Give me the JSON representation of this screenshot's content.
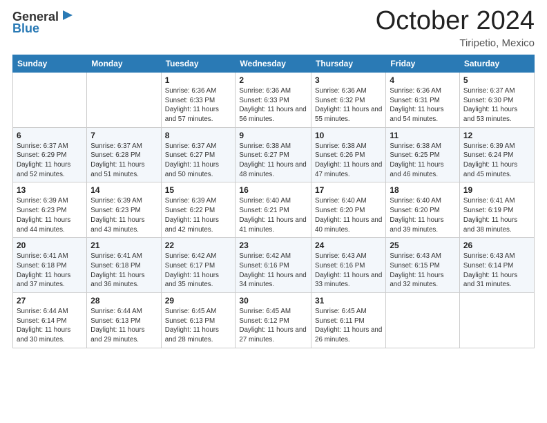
{
  "header": {
    "logo_general": "General",
    "logo_blue": "Blue",
    "month": "October 2024",
    "location": "Tiripetio, Mexico"
  },
  "weekdays": [
    "Sunday",
    "Monday",
    "Tuesday",
    "Wednesday",
    "Thursday",
    "Friday",
    "Saturday"
  ],
  "weeks": [
    [
      {
        "day": "",
        "info": ""
      },
      {
        "day": "",
        "info": ""
      },
      {
        "day": "1",
        "info": "Sunrise: 6:36 AM\nSunset: 6:33 PM\nDaylight: 11 hours and 57 minutes."
      },
      {
        "day": "2",
        "info": "Sunrise: 6:36 AM\nSunset: 6:33 PM\nDaylight: 11 hours and 56 minutes."
      },
      {
        "day": "3",
        "info": "Sunrise: 6:36 AM\nSunset: 6:32 PM\nDaylight: 11 hours and 55 minutes."
      },
      {
        "day": "4",
        "info": "Sunrise: 6:36 AM\nSunset: 6:31 PM\nDaylight: 11 hours and 54 minutes."
      },
      {
        "day": "5",
        "info": "Sunrise: 6:37 AM\nSunset: 6:30 PM\nDaylight: 11 hours and 53 minutes."
      }
    ],
    [
      {
        "day": "6",
        "info": "Sunrise: 6:37 AM\nSunset: 6:29 PM\nDaylight: 11 hours and 52 minutes."
      },
      {
        "day": "7",
        "info": "Sunrise: 6:37 AM\nSunset: 6:28 PM\nDaylight: 11 hours and 51 minutes."
      },
      {
        "day": "8",
        "info": "Sunrise: 6:37 AM\nSunset: 6:27 PM\nDaylight: 11 hours and 50 minutes."
      },
      {
        "day": "9",
        "info": "Sunrise: 6:38 AM\nSunset: 6:27 PM\nDaylight: 11 hours and 48 minutes."
      },
      {
        "day": "10",
        "info": "Sunrise: 6:38 AM\nSunset: 6:26 PM\nDaylight: 11 hours and 47 minutes."
      },
      {
        "day": "11",
        "info": "Sunrise: 6:38 AM\nSunset: 6:25 PM\nDaylight: 11 hours and 46 minutes."
      },
      {
        "day": "12",
        "info": "Sunrise: 6:39 AM\nSunset: 6:24 PM\nDaylight: 11 hours and 45 minutes."
      }
    ],
    [
      {
        "day": "13",
        "info": "Sunrise: 6:39 AM\nSunset: 6:23 PM\nDaylight: 11 hours and 44 minutes."
      },
      {
        "day": "14",
        "info": "Sunrise: 6:39 AM\nSunset: 6:23 PM\nDaylight: 11 hours and 43 minutes."
      },
      {
        "day": "15",
        "info": "Sunrise: 6:39 AM\nSunset: 6:22 PM\nDaylight: 11 hours and 42 minutes."
      },
      {
        "day": "16",
        "info": "Sunrise: 6:40 AM\nSunset: 6:21 PM\nDaylight: 11 hours and 41 minutes."
      },
      {
        "day": "17",
        "info": "Sunrise: 6:40 AM\nSunset: 6:20 PM\nDaylight: 11 hours and 40 minutes."
      },
      {
        "day": "18",
        "info": "Sunrise: 6:40 AM\nSunset: 6:20 PM\nDaylight: 11 hours and 39 minutes."
      },
      {
        "day": "19",
        "info": "Sunrise: 6:41 AM\nSunset: 6:19 PM\nDaylight: 11 hours and 38 minutes."
      }
    ],
    [
      {
        "day": "20",
        "info": "Sunrise: 6:41 AM\nSunset: 6:18 PM\nDaylight: 11 hours and 37 minutes."
      },
      {
        "day": "21",
        "info": "Sunrise: 6:41 AM\nSunset: 6:18 PM\nDaylight: 11 hours and 36 minutes."
      },
      {
        "day": "22",
        "info": "Sunrise: 6:42 AM\nSunset: 6:17 PM\nDaylight: 11 hours and 35 minutes."
      },
      {
        "day": "23",
        "info": "Sunrise: 6:42 AM\nSunset: 6:16 PM\nDaylight: 11 hours and 34 minutes."
      },
      {
        "day": "24",
        "info": "Sunrise: 6:43 AM\nSunset: 6:16 PM\nDaylight: 11 hours and 33 minutes."
      },
      {
        "day": "25",
        "info": "Sunrise: 6:43 AM\nSunset: 6:15 PM\nDaylight: 11 hours and 32 minutes."
      },
      {
        "day": "26",
        "info": "Sunrise: 6:43 AM\nSunset: 6:14 PM\nDaylight: 11 hours and 31 minutes."
      }
    ],
    [
      {
        "day": "27",
        "info": "Sunrise: 6:44 AM\nSunset: 6:14 PM\nDaylight: 11 hours and 30 minutes."
      },
      {
        "day": "28",
        "info": "Sunrise: 6:44 AM\nSunset: 6:13 PM\nDaylight: 11 hours and 29 minutes."
      },
      {
        "day": "29",
        "info": "Sunrise: 6:45 AM\nSunset: 6:13 PM\nDaylight: 11 hours and 28 minutes."
      },
      {
        "day": "30",
        "info": "Sunrise: 6:45 AM\nSunset: 6:12 PM\nDaylight: 11 hours and 27 minutes."
      },
      {
        "day": "31",
        "info": "Sunrise: 6:45 AM\nSunset: 6:11 PM\nDaylight: 11 hours and 26 minutes."
      },
      {
        "day": "",
        "info": ""
      },
      {
        "day": "",
        "info": ""
      }
    ]
  ]
}
